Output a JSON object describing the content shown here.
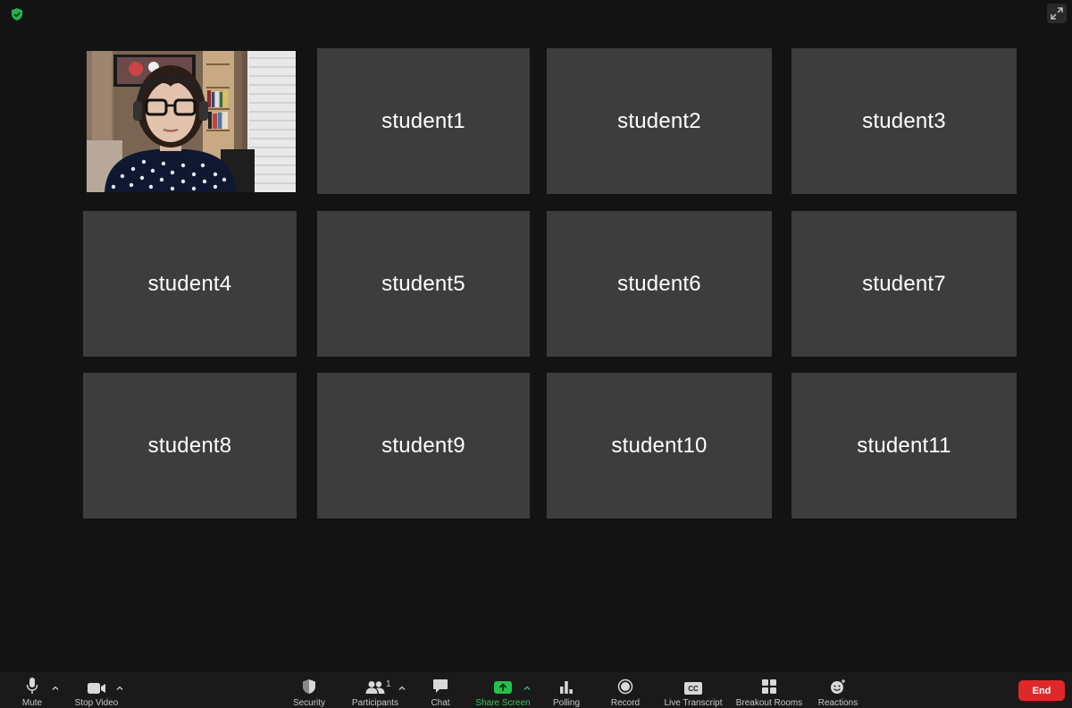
{
  "app": {
    "accent_color": "#3ec45a",
    "tile_color": "#3d3d3d",
    "background_color": "#131313",
    "end_color": "#e02828"
  },
  "gallery": {
    "tiles": [
      {
        "name": "student1"
      },
      {
        "name": "student2"
      },
      {
        "name": "student3"
      },
      {
        "name": "student4"
      },
      {
        "name": "student5"
      },
      {
        "name": "student6"
      },
      {
        "name": "student7"
      },
      {
        "name": "student8"
      },
      {
        "name": "student9"
      },
      {
        "name": "student10"
      },
      {
        "name": "student11"
      }
    ]
  },
  "toolbar": {
    "mute_label": "Mute",
    "stop_video_label": "Stop Video",
    "security_label": "Security",
    "participants_label": "Participants",
    "participants_count": "1",
    "chat_label": "Chat",
    "share_screen_label": "Share Screen",
    "polling_label": "Polling",
    "record_label": "Record",
    "live_transcript_label": "Live Transcript",
    "live_transcript_icon_text": "CC",
    "breakout_rooms_label": "Breakout Rooms",
    "reactions_label": "Reactions",
    "end_label": "End"
  },
  "icons": {
    "top_left": "shield-check-icon",
    "top_right": "expand-icon"
  }
}
